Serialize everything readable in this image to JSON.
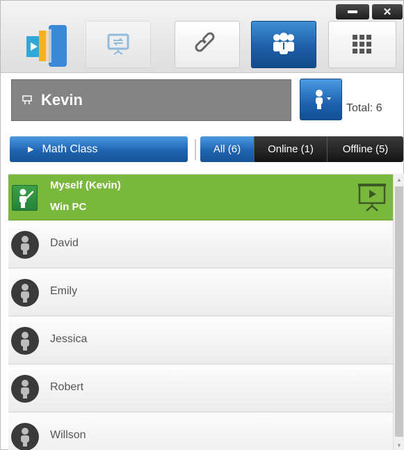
{
  "window": {
    "minimize_icon": "minimize-icon",
    "close_label": "✕"
  },
  "toolbar": {
    "buttons": [
      {
        "name": "screen-share-button",
        "icon": "screen-share-icon",
        "enabled": false
      },
      {
        "name": "link-button",
        "icon": "link-icon",
        "active": false
      },
      {
        "name": "users-button",
        "icon": "group-icon",
        "active": true
      },
      {
        "name": "apps-button",
        "icon": "grid-icon",
        "active": false
      }
    ]
  },
  "user": {
    "name": "Kevin",
    "total_label": "Total: 6"
  },
  "class_button": {
    "label": "Math Class"
  },
  "filters": {
    "all": "All (6)",
    "online": "Online (1)",
    "offline": "Offline (5)",
    "selected": "all"
  },
  "students": {
    "me": {
      "name": "Myself (Kevin)",
      "device": "Win PC"
    },
    "others": [
      {
        "name": "David"
      },
      {
        "name": "Emily"
      },
      {
        "name": "Jessica"
      },
      {
        "name": "Robert"
      },
      {
        "name": "Willson"
      }
    ]
  },
  "colors": {
    "accent_blue": "#1f64b2",
    "me_row_green": "#7ab83d",
    "user_bar_gray": "#848484",
    "filter_dark": "#1e1e1e"
  }
}
